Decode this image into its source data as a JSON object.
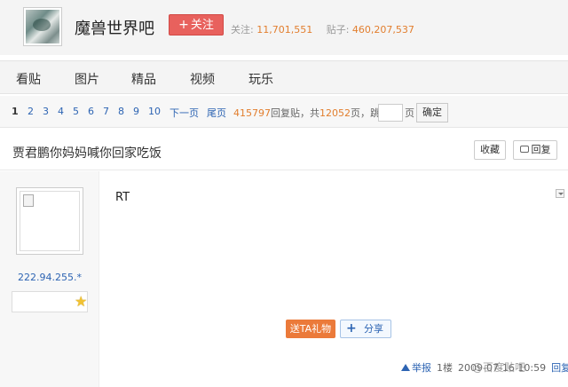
{
  "header": {
    "forum_name": "魔兽世界吧",
    "follow_label": "关注",
    "follow_icon": "plus-icon",
    "followers_label": "关注:",
    "followers_count": "11,701,551",
    "posts_label": "贴子:",
    "posts_count": "460,207,537"
  },
  "nav": {
    "items": [
      "看贴",
      "图片",
      "精品",
      "视频",
      "玩乐"
    ]
  },
  "pager": {
    "pages": [
      "1",
      "2",
      "3",
      "4",
      "5",
      "6",
      "7",
      "8",
      "9",
      "10"
    ],
    "current_page": "1",
    "next_label": "下一页",
    "last_label": "尾页",
    "reply_count": "415797",
    "reply_suffix": "回复贴，共",
    "total_pages": "12052",
    "pages_suffix": "页，跳到",
    "page_unit": "页",
    "confirm_label": "确定"
  },
  "thread": {
    "title": "贾君鹏你妈妈喊你回家吃饭",
    "favorite_label": "收藏",
    "reply_label": "回复"
  },
  "post": {
    "author_ip": "222.94.255.*",
    "content": "RT",
    "gift_label": "送TA礼物",
    "share_label": "分享",
    "report_label": "举报",
    "floor": "1楼",
    "time": "2009-07-16 10:59",
    "reply_link": "回复"
  },
  "watermark": "@百度贴吧",
  "colors": {
    "follow_button": "#e8615d",
    "highlight_number": "#e27e2e",
    "link_blue": "#2d64b3",
    "gift_button": "#eb7a3a"
  }
}
